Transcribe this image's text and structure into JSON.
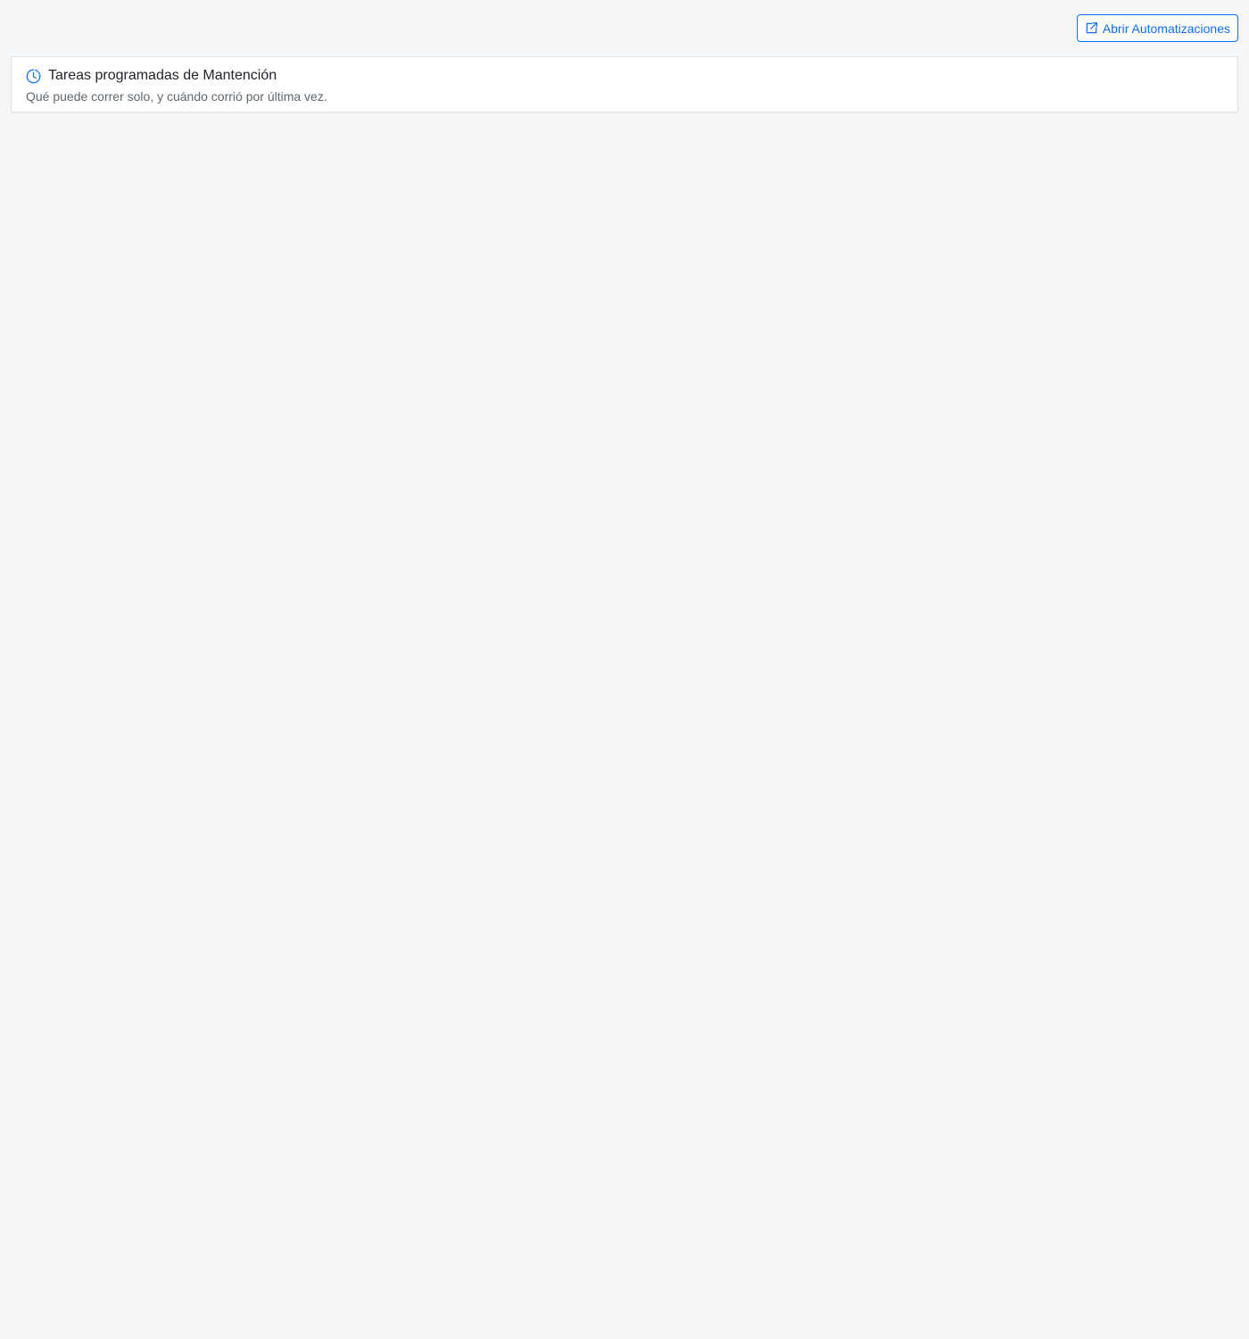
{
  "toolbar": {
    "open_automations_label": "Abrir Automatizaciones",
    "open_automations_icon": "external-link-icon"
  },
  "card": {
    "icon": "clock-icon",
    "title": "Tareas programadas de Mantención",
    "subtitle": "Qué puede correr solo, y cuándo corrió por última vez."
  },
  "colors": {
    "background": "#f4f6f8",
    "accent": "#0d6efd",
    "card_background": "#ffffff",
    "card_border": "#dfe3e8",
    "subtitle_text": "#5f6770"
  }
}
